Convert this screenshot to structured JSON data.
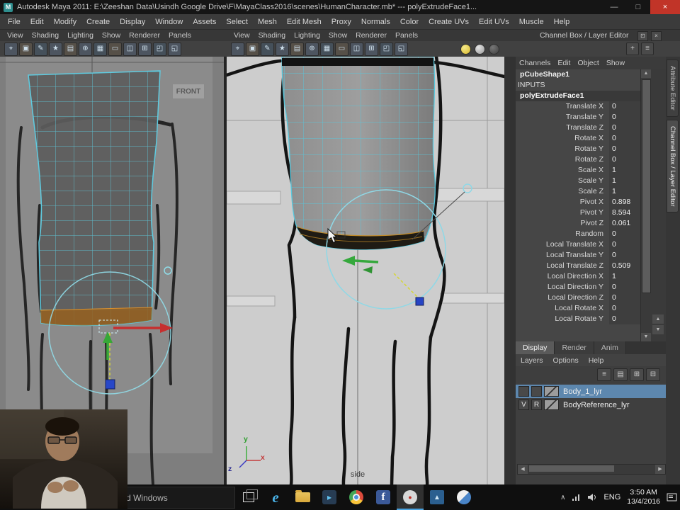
{
  "window": {
    "logo": "M",
    "title": "Autodesk Maya 2011: E:\\Zeeshan Data\\Usindh Google Drive\\F\\MayaClass2016\\scenes\\HumanCharacter.mb*   ---   polyExtrudeFace1...",
    "minimize": "—",
    "maximize": "□",
    "close": "×"
  },
  "menu_bar": [
    "File",
    "Edit",
    "Modify",
    "Create",
    "Display",
    "Window",
    "Assets",
    "Select",
    "Mesh",
    "Edit Mesh",
    "Proxy",
    "Normals",
    "Color",
    "Create UVs",
    "Edit UVs",
    "Muscle",
    "Help"
  ],
  "panel_menus": [
    "View",
    "Shading",
    "Lighting",
    "Show",
    "Renderer",
    "Panels"
  ],
  "panel_dock": {
    "label": "Channel Box / Layer Editor",
    "icons": [
      {
        "name": "dock-panel-icon",
        "glyph": "⊡"
      },
      {
        "name": "close-panel-icon",
        "glyph": "×"
      }
    ]
  },
  "viewport_toolbar_icons": [
    {
      "name": "select-camera-icon",
      "glyph": "⌖"
    },
    {
      "name": "lock-camera-icon",
      "glyph": "▣"
    },
    {
      "name": "camera-attributes-icon",
      "glyph": "✎"
    },
    {
      "name": "bookmark-icon",
      "glyph": "★"
    },
    {
      "name": "image-plane-icon",
      "glyph": "▤"
    },
    {
      "name": "two-d-pan-zoom-icon",
      "glyph": "⊕"
    },
    {
      "name": "grid-icon",
      "glyph": "▦"
    },
    {
      "name": "film-gate-icon",
      "glyph": "▭"
    },
    {
      "name": "resolution-gate-icon",
      "glyph": "◫"
    },
    {
      "name": "field-chart-icon",
      "glyph": "⊞"
    },
    {
      "name": "safe-action-icon",
      "glyph": "◰"
    },
    {
      "name": "safe-title-icon",
      "glyph": "◱"
    }
  ],
  "channelbox_toolbar": [
    {
      "name": "show-manipulator-icon",
      "glyph": "+"
    },
    {
      "name": "channel-speed-menu-icon",
      "glyph": "≡"
    }
  ],
  "viewports": {
    "front": {
      "label": "FRONT"
    },
    "side": {
      "label": "side",
      "axis_x": "x",
      "axis_y": "y",
      "axis_z": "z"
    }
  },
  "channel_box": {
    "menus": [
      "Channels",
      "Edit",
      "Object",
      "Show"
    ],
    "shape_node": "pCubeShape1",
    "inputs_header": "INPUTS",
    "input_node": "polyExtrudeFace1",
    "attributes": [
      {
        "name": "Translate X",
        "value": "0"
      },
      {
        "name": "Translate Y",
        "value": "0"
      },
      {
        "name": "Translate Z",
        "value": "0"
      },
      {
        "name": "Rotate X",
        "value": "0"
      },
      {
        "name": "Rotate Y",
        "value": "0"
      },
      {
        "name": "Rotate Z",
        "value": "0"
      },
      {
        "name": "Scale X",
        "value": "1"
      },
      {
        "name": "Scale Y",
        "value": "1"
      },
      {
        "name": "Scale Z",
        "value": "1"
      },
      {
        "name": "Pivot X",
        "value": "0.898"
      },
      {
        "name": "Pivot Y",
        "value": "8.594"
      },
      {
        "name": "Pivot Z",
        "value": "0.061"
      },
      {
        "name": "Random",
        "value": "0"
      },
      {
        "name": "Local Translate X",
        "value": "0"
      },
      {
        "name": "Local Translate Y",
        "value": "0"
      },
      {
        "name": "Local Translate Z",
        "value": "0.509"
      },
      {
        "name": "Local Direction X",
        "value": "1"
      },
      {
        "name": "Local Direction Y",
        "value": "0"
      },
      {
        "name": "Local Direction Z",
        "value": "0"
      },
      {
        "name": "Local Rotate X",
        "value": "0"
      },
      {
        "name": "Local Rotate Y",
        "value": "0"
      }
    ]
  },
  "layer_editor": {
    "tabs": [
      {
        "label": "Display",
        "active": true
      },
      {
        "label": "Render",
        "active": false
      },
      {
        "label": "Anim",
        "active": false
      }
    ],
    "menus": [
      "Layers",
      "Options",
      "Help"
    ],
    "toolbar": [
      {
        "name": "layer-sort-icon",
        "glyph": "≡"
      },
      {
        "name": "layer-attributes-icon",
        "glyph": "▤"
      },
      {
        "name": "new-empty-layer-icon",
        "glyph": "⊞"
      },
      {
        "name": "new-layer-from-selected-icon",
        "glyph": "⊟"
      }
    ],
    "layers": [
      {
        "v": "",
        "r": "",
        "name": "Body_1_lyr",
        "selected": true
      },
      {
        "v": "V",
        "r": "R",
        "name": "BodyReference_lyr",
        "selected": false
      }
    ]
  },
  "side_tabs": [
    {
      "label": "Attribute Editor",
      "active": false
    },
    {
      "label": "Channel Box / Layer Editor",
      "active": true
    }
  ],
  "taskbar": {
    "search_placeholder": "Search the web and Windows",
    "apps": [
      {
        "name": "task-view-icon",
        "glyph": ""
      },
      {
        "name": "internet-explorer-icon",
        "glyph": "e"
      },
      {
        "name": "file-explorer-icon",
        "glyph": ""
      },
      {
        "name": "media-player-icon",
        "glyph": "▸"
      },
      {
        "name": "chrome-icon",
        "glyph": ""
      },
      {
        "name": "facebook-icon",
        "glyph": "f"
      },
      {
        "name": "screen-recorder-icon",
        "glyph": "●",
        "active": true
      },
      {
        "name": "photos-icon",
        "glyph": "▲"
      },
      {
        "name": "gom-player-icon",
        "glyph": ""
      }
    ],
    "tray_expand": "∧",
    "language": "ENG",
    "time": "3:50 AM",
    "date": "13/4/2016"
  },
  "colors": {
    "wireframe_cyan": "#5ecbe0",
    "selected_face_orange": "#96601e",
    "selection_blue": "#5d87ae",
    "manip_x_red": "#c62f2f",
    "manip_y_green": "#37a837",
    "manip_z_blue": "#2747c8",
    "close_button_red": "#c13428"
  }
}
